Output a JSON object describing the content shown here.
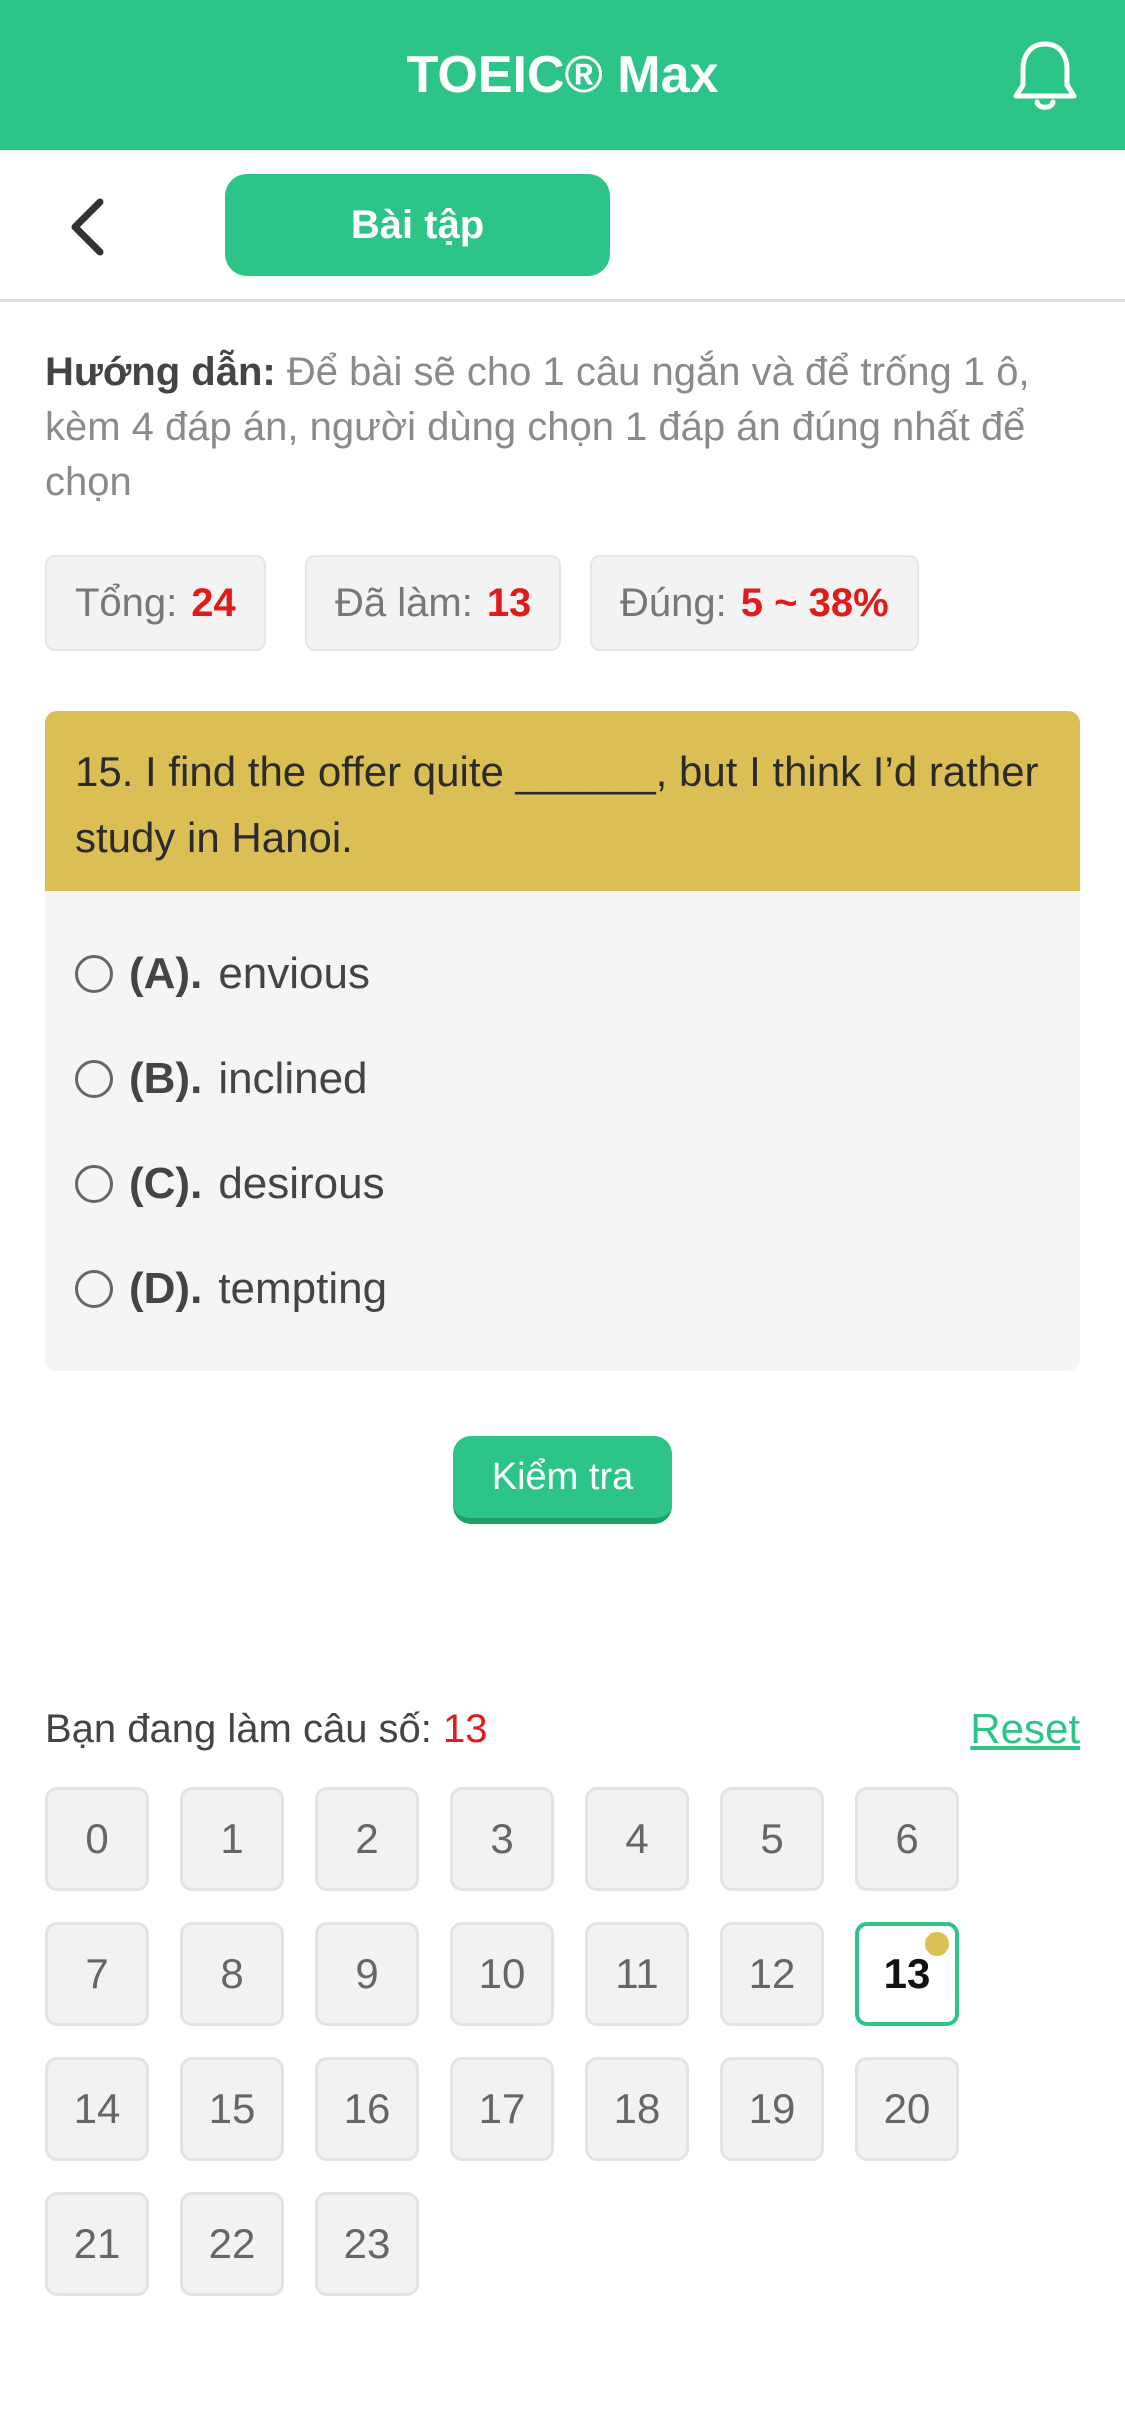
{
  "header": {
    "title": "TOEIC® Max",
    "notification_icon": "bell-icon"
  },
  "subbar": {
    "back_icon": "chevron-left-icon",
    "tab_label": "Bài tập"
  },
  "instructions": {
    "label": "Hướng dẫn:",
    "text": " Để bài sẽ cho 1 câu ngắn và để trống 1 ô, kèm 4 đáp án, người dùng chọn 1 đáp án đúng nhất để chọn"
  },
  "stats": {
    "total": {
      "label": "Tổng:",
      "value": "24"
    },
    "done": {
      "label": "Đã làm:",
      "value": "13"
    },
    "correct": {
      "label": "Đúng:",
      "value": "5 ~ 38%"
    }
  },
  "question": {
    "text": "15. I find the offer quite ______, but I think I’d rather study in Hanoi.",
    "options": [
      {
        "letter": "(A).",
        "text": "envious"
      },
      {
        "letter": "(B).",
        "text": "inclined"
      },
      {
        "letter": "(C).",
        "text": "desirous"
      },
      {
        "letter": "(D).",
        "text": "tempting"
      }
    ]
  },
  "check_button": "Kiểm tra",
  "progress": {
    "label": "Bạn đang làm câu số:",
    "current": "13",
    "reset_label": "Reset"
  },
  "grid": {
    "items": [
      "0",
      "1",
      "2",
      "3",
      "4",
      "5",
      "6",
      "7",
      "8",
      "9",
      "10",
      "11",
      "12",
      "13",
      "14",
      "15",
      "16",
      "17",
      "18",
      "19",
      "20",
      "21",
      "22",
      "23"
    ],
    "active": "13"
  },
  "colors": {
    "brand": "#2dc487",
    "question_bg": "#dbbf55",
    "highlight": "#e01b1b"
  }
}
